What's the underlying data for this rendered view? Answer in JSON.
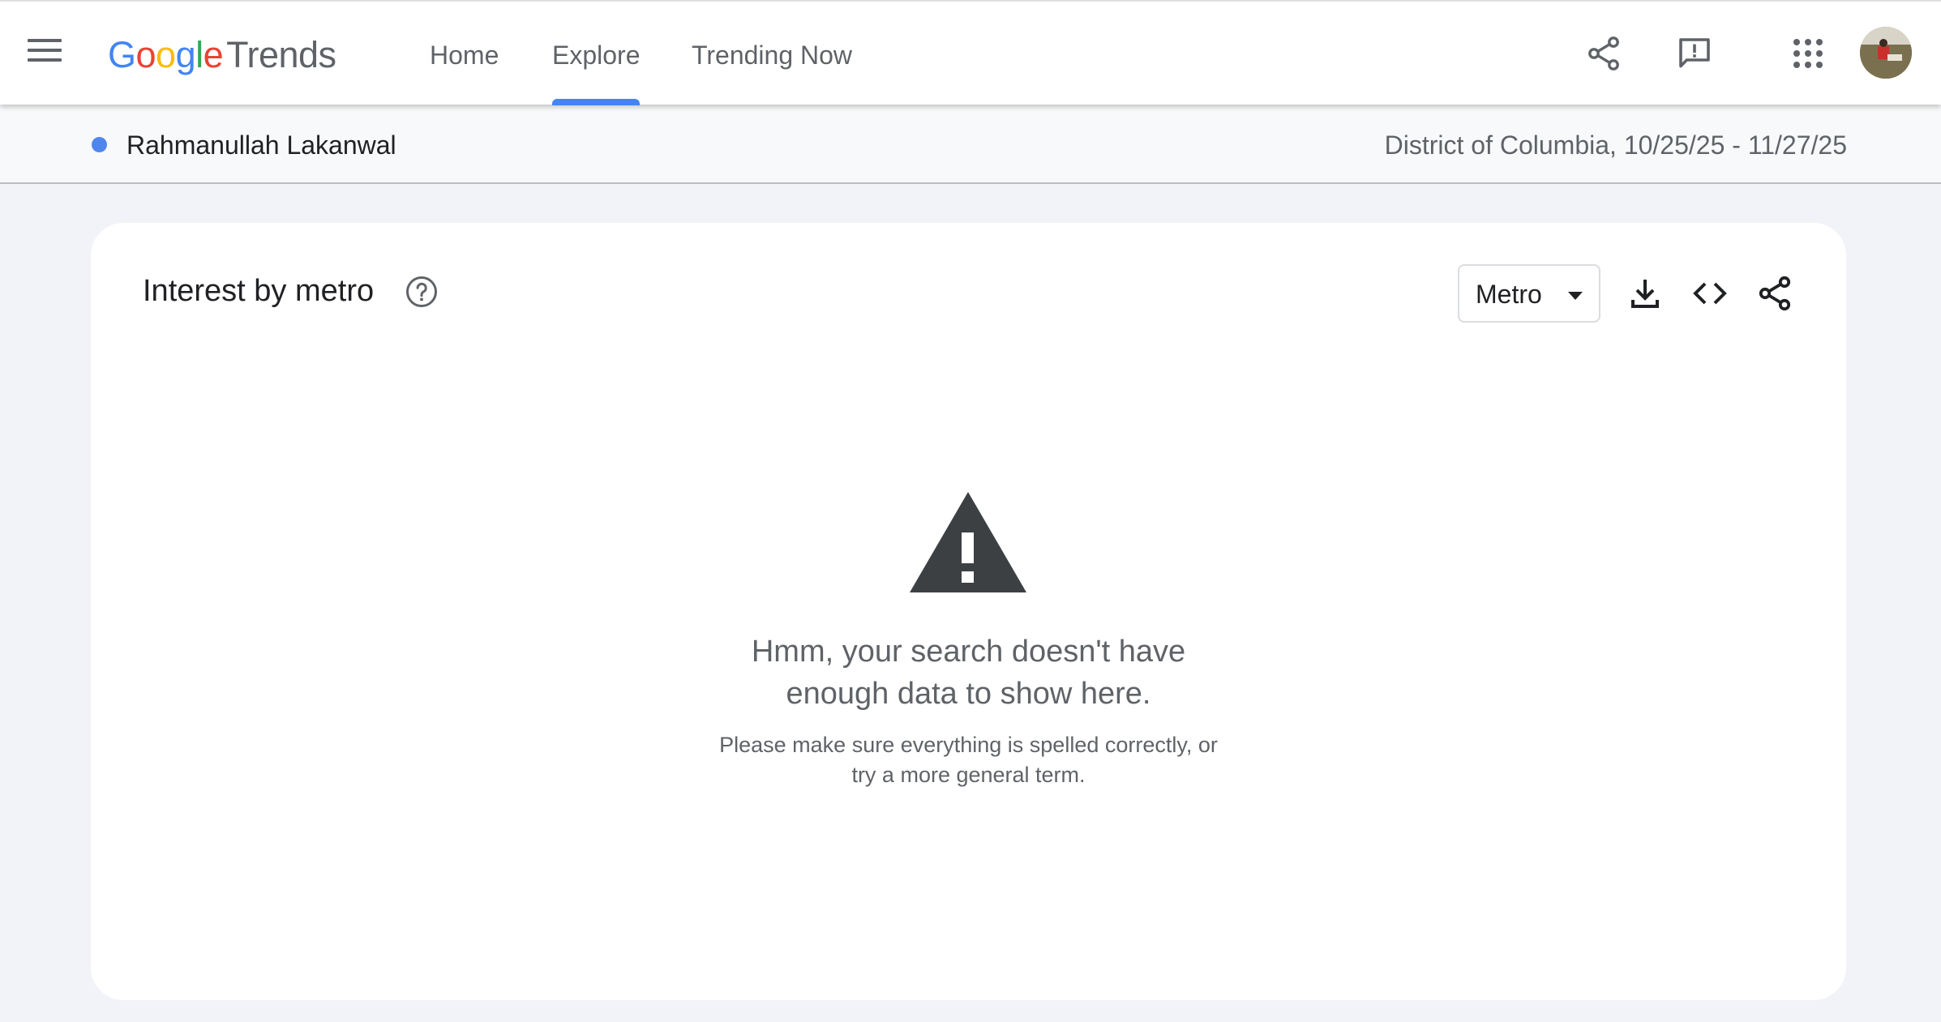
{
  "header": {
    "logo": {
      "google": [
        "G",
        "o",
        "o",
        "g",
        "l",
        "e"
      ],
      "product": "Trends"
    },
    "nav": [
      {
        "label": "Home",
        "active": false
      },
      {
        "label": "Explore",
        "active": true
      },
      {
        "label": "Trending Now",
        "active": false
      }
    ],
    "icons": [
      "menu-icon",
      "share-icon",
      "feedback-icon",
      "apps-grid-icon",
      "avatar"
    ]
  },
  "term_bar": {
    "term": "Rahmanullah Lakanwal",
    "term_color": "#4f86ec",
    "region_and_dates": "District of Columbia, 10/25/25 - 11/27/25"
  },
  "card": {
    "title": "Interest by metro",
    "resolution_select": {
      "value": "Metro"
    },
    "actions": [
      "download-icon",
      "embed-icon",
      "share-icon"
    ],
    "empty_state": {
      "icon": "warning-icon",
      "heading_line1": "Hmm, your search doesn't have",
      "heading_line2": "enough data to show here.",
      "hint_line1": "Please make sure everything is spelled correctly, or",
      "hint_line2": "try a more general term."
    }
  },
  "colors": {
    "accent": "#4285f4",
    "background": "#f1f3f8",
    "text_secondary": "#5f6368",
    "warning_icon": "#3c4043"
  }
}
